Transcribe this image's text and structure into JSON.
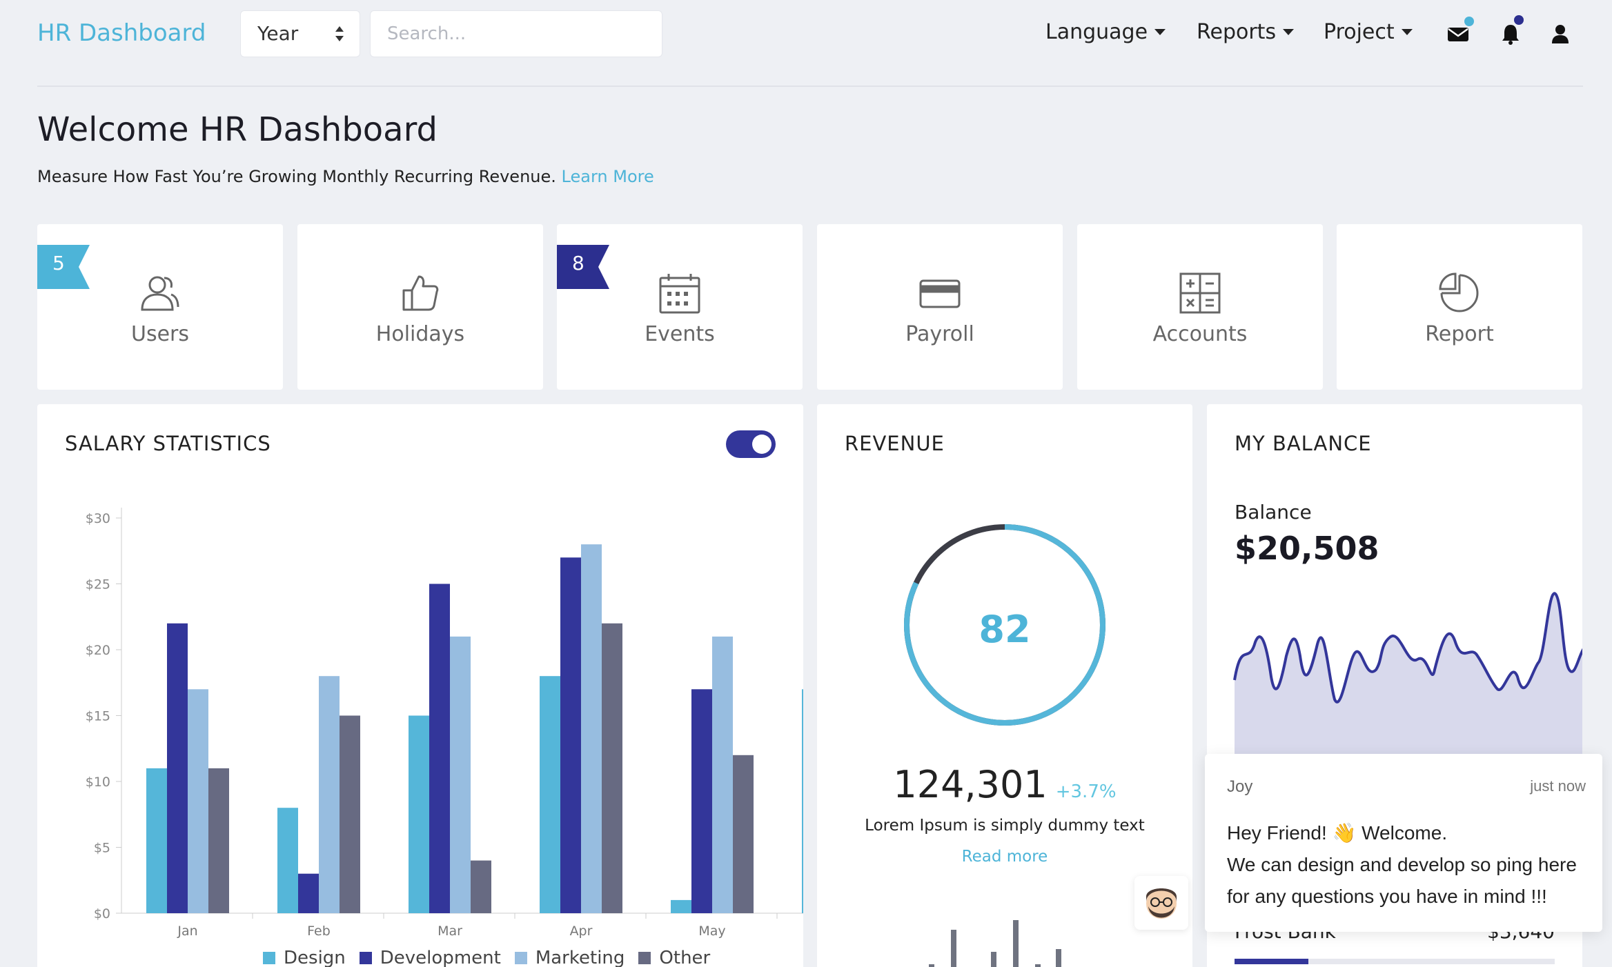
{
  "nav": {
    "brand": "HR Dashboard",
    "year_select": "Year",
    "search_placeholder": "Search...",
    "menus": [
      {
        "label": "Language"
      },
      {
        "label": "Reports"
      },
      {
        "label": "Project"
      }
    ],
    "icons": [
      "envelope-icon",
      "bell-icon",
      "user-icon"
    ],
    "colors": {
      "brand": "#4db4d8",
      "accent": "#33369a"
    }
  },
  "header": {
    "title": "Welcome HR Dashboard",
    "subtitle": "Measure How Fast You’re Growing Monthly Recurring Revenue.",
    "link": "Learn More"
  },
  "tiles": [
    {
      "label": "Users",
      "badge": "5",
      "icon": "users-icon"
    },
    {
      "label": "Holidays",
      "badge": "",
      "icon": "thumbs-up-icon"
    },
    {
      "label": "Events",
      "badge": "8",
      "icon": "calendar-icon"
    },
    {
      "label": "Payroll",
      "badge": "",
      "icon": "credit-card-icon"
    },
    {
      "label": "Accounts",
      "badge": "",
      "icon": "calculator-icon"
    },
    {
      "label": "Report",
      "badge": "",
      "icon": "pie-chart-icon"
    }
  ],
  "salary": {
    "title": "SALARY STATISTICS"
  },
  "chart_data": {
    "type": "bar",
    "categories": [
      "Jan",
      "Feb",
      "Mar",
      "Apr",
      "May",
      ""
    ],
    "series": [
      {
        "name": "Design",
        "color": "#55b6d9",
        "values": [
          11,
          8,
          15,
          18,
          1,
          17
        ]
      },
      {
        "name": "Development",
        "color": "#33369a",
        "values": [
          22,
          3,
          25,
          27,
          17,
          null
        ]
      },
      {
        "name": "Marketing",
        "color": "#97bde0",
        "values": [
          17,
          18,
          21,
          28,
          21,
          null
        ]
      },
      {
        "name": "Other",
        "color": "#676a82",
        "values": [
          11,
          15,
          4,
          22,
          12,
          null
        ]
      }
    ],
    "yticks": [
      "$0",
      "$5",
      "$10",
      "$15",
      "$20",
      "$25",
      "$30"
    ],
    "ylim": [
      0,
      30
    ],
    "legend": "bottom"
  },
  "revenue": {
    "title": "REVENUE",
    "gauge_value": "82",
    "gauge_fraction": 0.82,
    "amount": "124,301",
    "change": "+3.7%",
    "text": "Lorem Ipsum is simply dummy text",
    "link": "Read more"
  },
  "balance": {
    "title": "MY BALANCE",
    "label": "Balance",
    "value": "$20,508",
    "bank_name": "Frost Bank",
    "bank_amount": "$3,640",
    "bank_progress": 0.23
  },
  "chat": {
    "sender": "Joy",
    "time": "just now",
    "message_line1": "Hey Friend! 👋 Welcome.",
    "message_line2": "We can design and develop so ping here",
    "message_line3": "for any questions you have in mind !!!"
  }
}
